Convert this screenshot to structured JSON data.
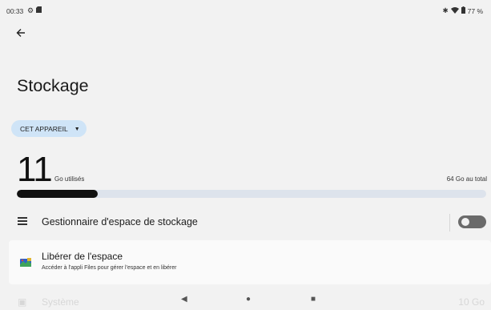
{
  "status_bar": {
    "time": "00:33",
    "icons": [
      "gear-icon",
      "sd-card-icon",
      "bluetooth-icon",
      "wifi-icon",
      "battery-icon"
    ],
    "battery": "77 %"
  },
  "header": {
    "back_icon": "back-arrow-icon",
    "title": "Stockage"
  },
  "device_selector": {
    "label": "CET APPAREIL",
    "icon": "chevron-down-icon"
  },
  "usage": {
    "used_value": "11",
    "used_label": "Go utilisés",
    "total_label": "64 Go au total",
    "fraction_used": 0.172
  },
  "storage_manager": {
    "label": "Gestionnaire d'espace de stockage",
    "icon": "storage-list-icon",
    "enabled": false
  },
  "free_space": {
    "title": "Libérer de l'espace",
    "subtitle": "Accéder à l'appli Files pour gérer l'espace et en libérer",
    "icon": "files-app-icon"
  },
  "partial_row": {
    "label": "Système",
    "value": "10 Go"
  },
  "nav": {
    "back": "◀",
    "home": "●",
    "recents": "■"
  },
  "colors": {
    "background": "#f2f2f2",
    "chip": "#cfe4f7",
    "bar_fill": "#111111",
    "bar_track": "#dde3ec",
    "toggle_off": "#6b6b6b"
  }
}
